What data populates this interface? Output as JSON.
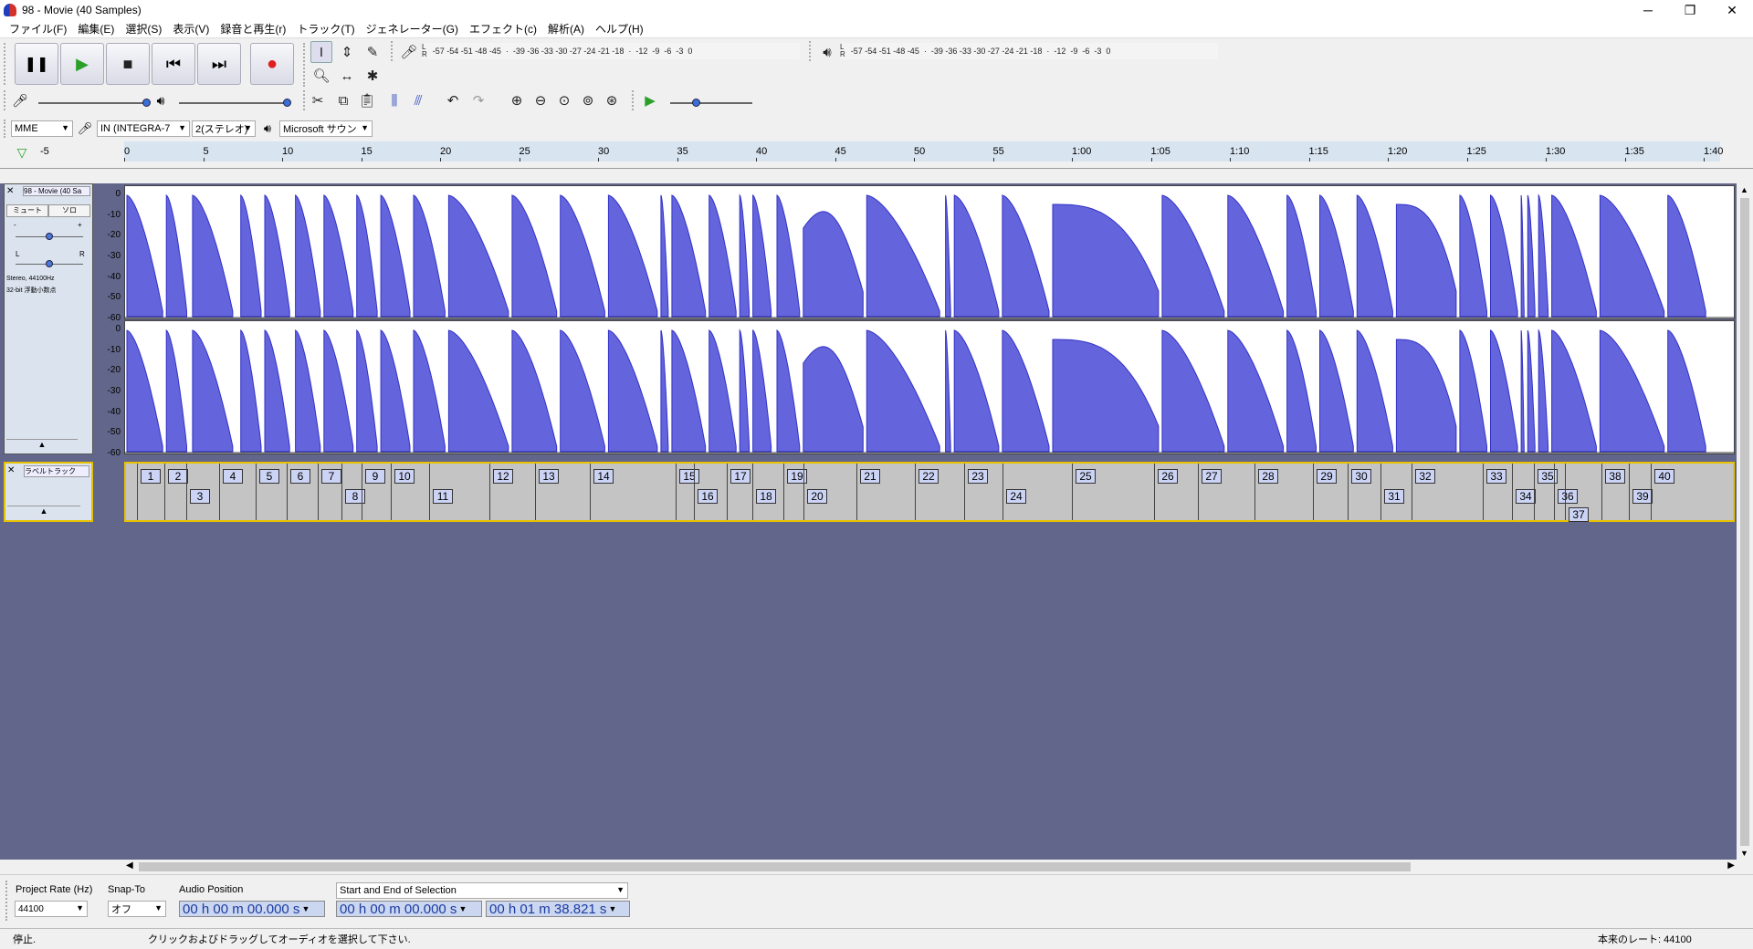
{
  "window": {
    "title": "98 - Movie (40 Samples)",
    "minimize": "─",
    "maximize": "❐",
    "close": "✕"
  },
  "menu": [
    "ファイル(F)",
    "編集(E)",
    "選択(S)",
    "表示(V)",
    "録音と再生(r)",
    "トラック(T)",
    "ジェネレーター(G)",
    "エフェクト(c)",
    "解析(A)",
    "ヘルプ(H)"
  ],
  "transport": {
    "pause": "❚❚",
    "play": "▶",
    "stop": "■",
    "skip_start": "⏮",
    "skip_end": "⏭",
    "record": "●"
  },
  "meters": {
    "rec_scale": "-57 -54 -51 -48 -45  ·  -39 -36 -33 -30 -27 -24 -21 -18  ·  -12  -9  -6  -3  0",
    "play_scale": "-57 -54 -51 -48 -45  ·  -39 -36 -33 -30 -27 -24 -21 -18  ·  -12  -9  -6  -3  0",
    "lr": "L\nR"
  },
  "device": {
    "host": "MME",
    "input": "IN (INTEGRA-7",
    "channels": "2(ステレオ)",
    "output": "Microsoft サウン"
  },
  "ruler": {
    "start_label": "-5",
    "ticks": [
      "0",
      "5",
      "10",
      "15",
      "20",
      "25",
      "30",
      "35",
      "40",
      "45",
      "50",
      "55",
      "1:00",
      "1:05",
      "1:10",
      "1:15",
      "1:20",
      "1:25",
      "1:30",
      "1:35",
      "1:40"
    ]
  },
  "audio_track": {
    "name": "98 - Movie (40 Sa",
    "mute": "ミュート",
    "solo": "ソロ",
    "gain_minus": "-",
    "gain_plus": "+",
    "pan_l": "L",
    "pan_r": "R",
    "info1": "Stereo, 44100Hz",
    "info2": "32-bit 浮動小数点",
    "scale": [
      "0",
      "-10",
      "-20",
      "-30",
      "-40",
      "-50",
      "-60"
    ]
  },
  "label_track": {
    "name": "ラベルトラック",
    "labels": [
      "1",
      "2",
      "3",
      "4",
      "5",
      "6",
      "7",
      "8",
      "9",
      "10",
      "11",
      "12",
      "13",
      "14",
      "15",
      "16",
      "17",
      "18",
      "19",
      "20",
      "21",
      "22",
      "23",
      "24",
      "25",
      "26",
      "27",
      "28",
      "29",
      "30",
      "31",
      "32",
      "33",
      "34",
      "35",
      "36",
      "37",
      "38",
      "39",
      "40"
    ]
  },
  "selection_toolbar": {
    "project_rate_label": "Project Rate (Hz)",
    "project_rate": "44100",
    "snap_label": "Snap-To",
    "snap_value": "オフ",
    "audio_position_label": "Audio Position",
    "audio_position": "00 h 00 m 00.000 s",
    "selection_mode": "Start and End of Selection",
    "sel_start": "00 h 00 m 00.000 s",
    "sel_end": "00 h 01 m 38.821 s"
  },
  "status": {
    "state": "停止.",
    "hint": "クリックおよびドラッグしてオーディオを選択して下さい.",
    "rate": "本来のレート: 44100"
  },
  "colors": {
    "wave": "#3232c8",
    "wave_fill": "#6464dc",
    "track_bg": "#62668a",
    "label_border": "#e6c200",
    "time_text": "#1b3ca0"
  }
}
